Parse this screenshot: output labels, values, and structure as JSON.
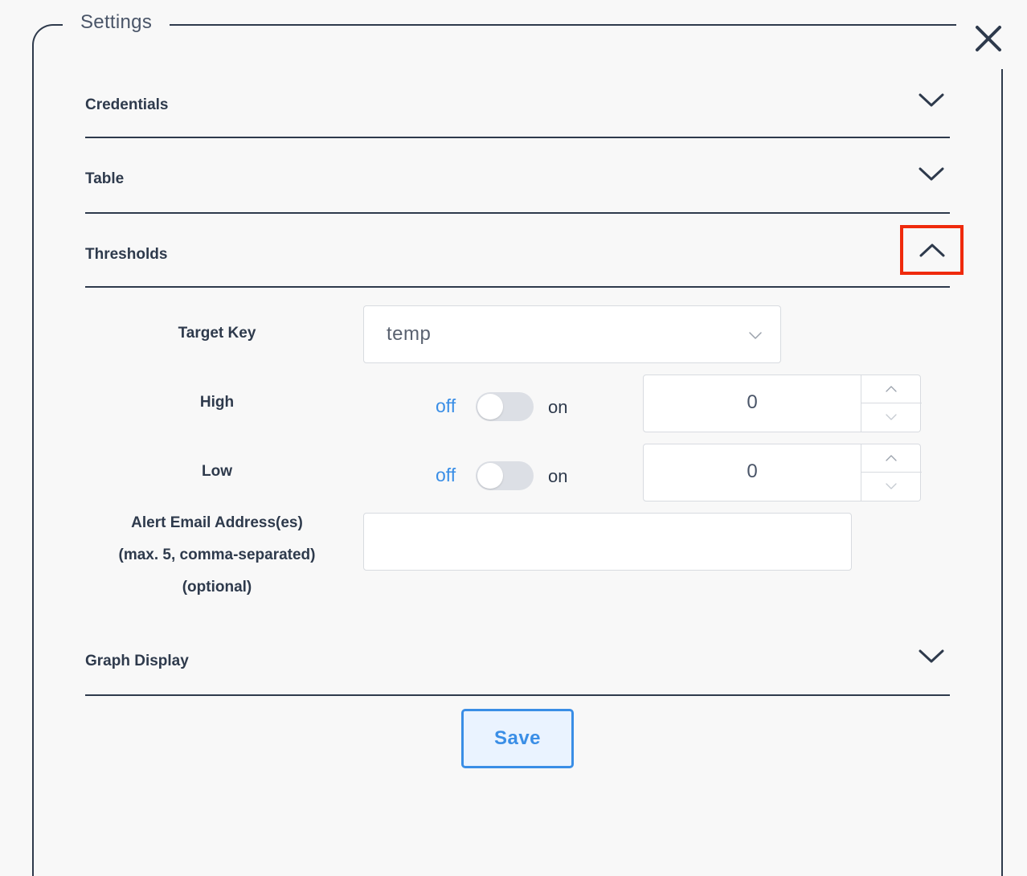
{
  "dialog": {
    "title": "Settings"
  },
  "sections": {
    "credentials": {
      "title": "Credentials",
      "expanded": false
    },
    "table": {
      "title": "Table",
      "expanded": false
    },
    "thresholds": {
      "title": "Thresholds",
      "expanded": true
    },
    "graph_display": {
      "title": "Graph Display",
      "expanded": false
    }
  },
  "thresholds": {
    "target_key": {
      "label": "Target Key",
      "value": "temp"
    },
    "high": {
      "label": "High",
      "off_label": "off",
      "on_label": "on",
      "enabled": false,
      "value": "0"
    },
    "low": {
      "label": "Low",
      "off_label": "off",
      "on_label": "on",
      "enabled": false,
      "value": "0"
    },
    "email": {
      "label_line1": "Alert Email Address(es)",
      "label_line2": "(max. 5, comma-separated)",
      "label_line3": "(optional)",
      "value": ""
    }
  },
  "actions": {
    "save_label": "Save"
  },
  "colors": {
    "accent": "#3a8ee6",
    "highlight": "#ef2a0c",
    "text": "#2e3a4c"
  }
}
